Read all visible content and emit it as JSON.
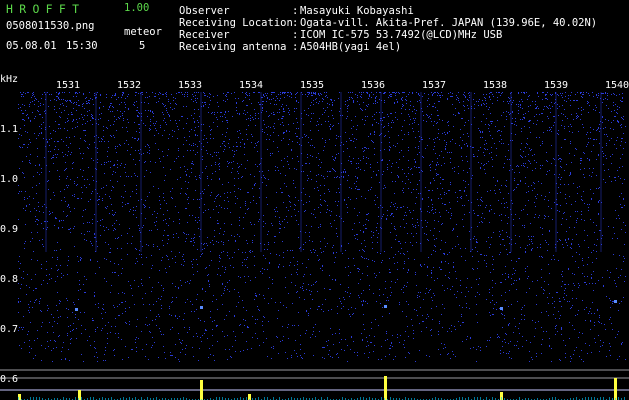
{
  "app": {
    "name": "HROFFT",
    "version": "1.00"
  },
  "file": {
    "name": "0508011530.png",
    "date": "05.08.01",
    "time": "15:30"
  },
  "meteor": {
    "label": "meteor",
    "count": "5"
  },
  "info": [
    {
      "label": "Observer",
      "sep": ":",
      "value": "Masayuki Kobayashi"
    },
    {
      "label": "Receiving Location",
      "sep": ":",
      "value": "Ogata-vill. Akita-Pref. JAPAN (139.96E, 40.02N)"
    },
    {
      "label": "Receiver",
      "sep": ":",
      "value": "ICOM IC-575 53.7492(@LCD)MHz USB"
    },
    {
      "label": "Receiving antenna",
      "sep": ":",
      "value": "A504HB(yagi 4el)"
    }
  ],
  "axis": {
    "y_unit": "kHz",
    "time_ticks": [
      "1531",
      "1532",
      "1533",
      "1534",
      "1535",
      "1536",
      "1537",
      "1538",
      "1539",
      "1540"
    ],
    "freq_ticks": [
      "1.1",
      "1.0",
      "0.9",
      "0.8",
      "0.7",
      "0.6"
    ],
    "freq_values": [
      1.1,
      1.0,
      0.9,
      0.8,
      0.7,
      0.6
    ]
  },
  "colors": {
    "logo": "#5cd84a",
    "noise": "#2a3bd8",
    "spike": "#ffff40",
    "bg": "#000000"
  }
}
